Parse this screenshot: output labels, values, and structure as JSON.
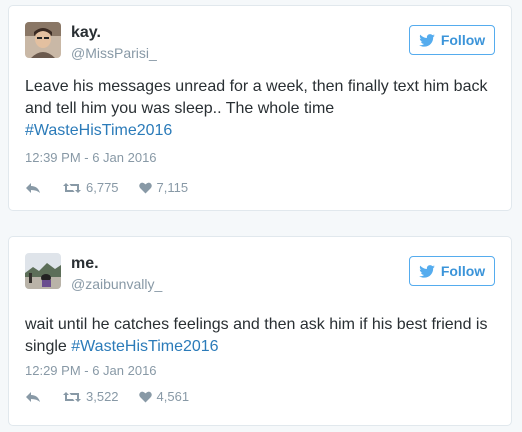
{
  "colors": {
    "page_bg": "#f5f8fa",
    "card_border": "#e1e8ed",
    "accent": "#55acee",
    "hashtag": "#2b7bb9",
    "muted": "#8899a6",
    "text": "#292f33"
  },
  "tweets": [
    {
      "display_name": "kay.",
      "handle": "@MissParisi_",
      "follow_label": "Follow",
      "text": "Leave his messages unread for a week, then finally text him back and tell him you was sleep.. The whole time",
      "hashtag": "#WasteHisTime2016",
      "timestamp": "12:39 PM - 6 Jan 2016",
      "retweets": "6,775",
      "likes": "7,115",
      "avatar_icon": "profile-photo-kay",
      "reply_icon": "reply-icon",
      "retweet_icon": "retweet-icon",
      "like_icon": "heart-icon"
    },
    {
      "display_name": "me.",
      "handle": "@zaibunvally_",
      "follow_label": "Follow",
      "text": "wait until he catches feelings and then ask him if his best friend is single",
      "hashtag": "#WasteHisTime2016",
      "timestamp": "12:29 PM - 6 Jan 2016",
      "retweets": "3,522",
      "likes": "4,561",
      "avatar_icon": "profile-photo-me",
      "reply_icon": "reply-icon",
      "retweet_icon": "retweet-icon",
      "like_icon": "heart-icon"
    }
  ]
}
